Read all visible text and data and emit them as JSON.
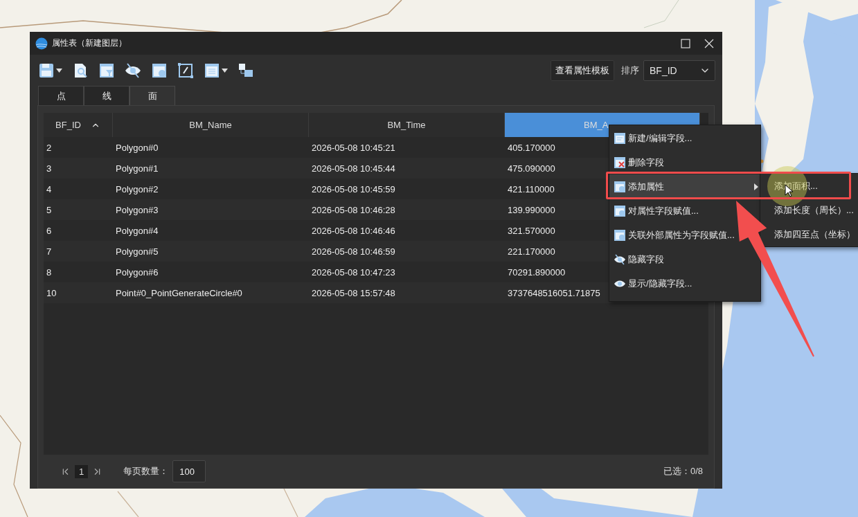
{
  "window": {
    "title": "属性表（新建图层）"
  },
  "toolbar": {
    "template_button": "查看属性模板",
    "sort_label": "排序",
    "sort_value": "BF_ID"
  },
  "tabs": [
    {
      "label": "点",
      "selected": false
    },
    {
      "label": "线",
      "selected": false
    },
    {
      "label": "面",
      "selected": true
    }
  ],
  "table": {
    "columns": [
      {
        "label": "BF_ID",
        "selected": false,
        "sorted_ascending": true
      },
      {
        "label": "BM_Name",
        "selected": false,
        "sorted_ascending": false
      },
      {
        "label": "BM_Time",
        "selected": false,
        "sorted_ascending": false
      },
      {
        "label": "BM_A",
        "selected": true,
        "sorted_ascending": false
      }
    ],
    "rows": [
      [
        "2",
        "Polygon#0",
        "2026-05-08 10:45:21",
        "405.170000"
      ],
      [
        "3",
        "Polygon#1",
        "2026-05-08 10:45:44",
        "475.090000"
      ],
      [
        "4",
        "Polygon#2",
        "2026-05-08 10:45:59",
        "421.110000"
      ],
      [
        "5",
        "Polygon#3",
        "2026-05-08 10:46:28",
        "139.990000"
      ],
      [
        "6",
        "Polygon#4",
        "2026-05-08 10:46:46",
        "321.570000"
      ],
      [
        "7",
        "Polygon#5",
        "2026-05-08 10:46:59",
        "221.170000"
      ],
      [
        "8",
        "Polygon#6",
        "2026-05-08 10:47:23",
        "70291.890000"
      ],
      [
        "10",
        "Point#0_PointGenerateCircle#0",
        "2026-05-08 15:57:48",
        "3737648516051.71875"
      ]
    ]
  },
  "footer": {
    "page": "1",
    "page_size_label": "每页数量：",
    "page_size": "100",
    "selection": "已选：0/8"
  },
  "context_menu": {
    "items": [
      {
        "label": "新建/编辑字段...",
        "selected": false,
        "has_submenu": false
      },
      {
        "label": "删除字段",
        "selected": false,
        "has_submenu": false
      },
      {
        "label": "添加属性",
        "selected": true,
        "has_submenu": true
      },
      {
        "label": "对属性字段赋值...",
        "selected": false,
        "has_submenu": false
      },
      {
        "label": "关联外部属性为字段赋值...",
        "selected": false,
        "has_submenu": false
      },
      {
        "label": "隐藏字段",
        "selected": false,
        "has_submenu": false
      },
      {
        "label": "显示/隐藏字段...",
        "selected": false,
        "has_submenu": false
      }
    ]
  },
  "submenu": {
    "items": [
      {
        "label": "添加面积..."
      },
      {
        "label": "添加长度（周长）..."
      },
      {
        "label": "添加四至点（坐标）"
      }
    ]
  }
}
